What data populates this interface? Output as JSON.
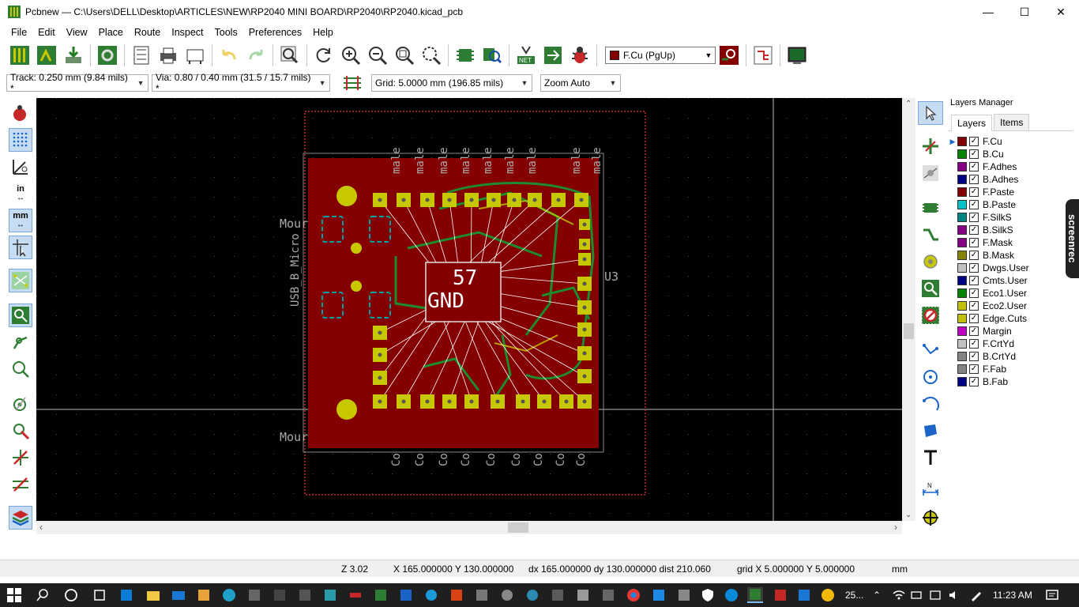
{
  "window": {
    "title": "Pcbnew — C:\\Users\\DELL\\Desktop\\ARTICLES\\NEW\\RP2040 MINI BOARD\\RP2040\\RP2040.kicad_pcb",
    "minimize": "—",
    "maximize": "☐",
    "close": "✕"
  },
  "menu": [
    "File",
    "Edit",
    "View",
    "Place",
    "Route",
    "Inspect",
    "Tools",
    "Preferences",
    "Help"
  ],
  "toolbar": {
    "layer_selector": {
      "value": "F.Cu (PgUp)",
      "color": "#840000"
    }
  },
  "aux_toolbar": {
    "track": "Track: 0.250 mm (9.84 mils) *",
    "via": "Via: 0.80 / 0.40 mm (31.5 / 15.7 mils) *",
    "grid": "Grid: 5.0000 mm (196.85 mils)",
    "zoom": "Zoom Auto"
  },
  "left_toolbar": {
    "units_in": "in",
    "units_mm": "mm"
  },
  "canvas": {
    "center_label_top": "57",
    "center_label_bottom": "GND",
    "mount_label_1": "Mour",
    "mount_label_2": "Mour",
    "usb_label": "USB_B_Micro",
    "u3_label": "U3",
    "top_connector_labels": [
      "male",
      "male",
      "male",
      "male",
      "male",
      "male",
      "male",
      "male",
      "male"
    ],
    "bottom_connector_labels": [
      "Co",
      "Co",
      "Co",
      "Co",
      "Co",
      "Co",
      "Co",
      "Co",
      "Co"
    ],
    "board_color": "#840000",
    "pad_color": "#c8c800"
  },
  "layers_manager": {
    "title": "Layers Manager",
    "tabs": [
      "Layers",
      "Items"
    ],
    "layers": [
      {
        "name": "F.Cu",
        "color": "#840000",
        "checked": true,
        "active": true
      },
      {
        "name": "B.Cu",
        "color": "#008400",
        "checked": true
      },
      {
        "name": "F.Adhes",
        "color": "#840084",
        "checked": true
      },
      {
        "name": "B.Adhes",
        "color": "#000084",
        "checked": true
      },
      {
        "name": "F.Paste",
        "color": "#840000",
        "checked": true
      },
      {
        "name": "B.Paste",
        "color": "#00c2c2",
        "checked": true
      },
      {
        "name": "F.SilkS",
        "color": "#008484",
        "checked": true
      },
      {
        "name": "B.SilkS",
        "color": "#840084",
        "checked": true
      },
      {
        "name": "F.Mask",
        "color": "#840084",
        "checked": true
      },
      {
        "name": "B.Mask",
        "color": "#848400",
        "checked": true
      },
      {
        "name": "Dwgs.User",
        "color": "#c2c2c2",
        "checked": true
      },
      {
        "name": "Cmts.User",
        "color": "#000084",
        "checked": true
      },
      {
        "name": "Eco1.User",
        "color": "#008400",
        "checked": true
      },
      {
        "name": "Eco2.User",
        "color": "#c2c200",
        "checked": true
      },
      {
        "name": "Edge.Cuts",
        "color": "#c2c200",
        "checked": true
      },
      {
        "name": "Margin",
        "color": "#c200c2",
        "checked": true
      },
      {
        "name": "F.CrtYd",
        "color": "#c2c2c2",
        "checked": true
      },
      {
        "name": "B.CrtYd",
        "color": "#848484",
        "checked": true
      },
      {
        "name": "F.Fab",
        "color": "#848484",
        "checked": true
      },
      {
        "name": "B.Fab",
        "color": "#000084",
        "checked": true
      }
    ]
  },
  "status": {
    "zoom": "Z 3.02",
    "xy": "X 165.000000  Y 130.000000",
    "delta": "dx 165.000000  dy 130.000000  dist 210.060",
    "grid": "grid X 5.000000  Y 5.000000",
    "units": "mm"
  },
  "overlay": {
    "screenrec": "screenrec"
  },
  "taskbar": {
    "weather": "25...",
    "time": "11:23 AM"
  }
}
